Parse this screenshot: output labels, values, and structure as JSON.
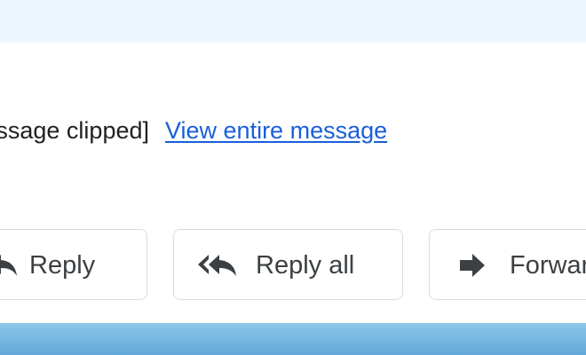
{
  "message": {
    "clipped_text": "[Message clipped]",
    "view_entire_link": "View entire message"
  },
  "actions": {
    "reply_label": "Reply",
    "reply_all_label": "Reply all",
    "forward_label": "Forward"
  },
  "icons": {
    "reply": "reply-icon",
    "reply_all": "reply-all-icon",
    "forward": "forward-icon"
  },
  "colors": {
    "link": "#1a5fd8",
    "top_band": "#ecf6fd",
    "bottom_band": "#7ab9e2",
    "button_border": "#dadce0",
    "button_text": "#3c4043"
  }
}
